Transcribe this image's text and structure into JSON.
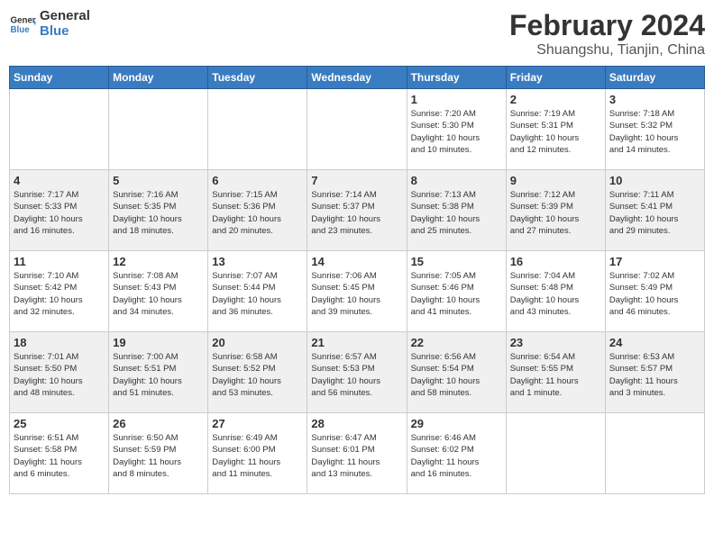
{
  "logo": {
    "line1": "General",
    "line2": "Blue"
  },
  "title": "February 2024",
  "subtitle": "Shuangshu, Tianjin, China",
  "days_of_week": [
    "Sunday",
    "Monday",
    "Tuesday",
    "Wednesday",
    "Thursday",
    "Friday",
    "Saturday"
  ],
  "weeks": [
    [
      {
        "day": "",
        "info": ""
      },
      {
        "day": "",
        "info": ""
      },
      {
        "day": "",
        "info": ""
      },
      {
        "day": "",
        "info": ""
      },
      {
        "day": "1",
        "info": "Sunrise: 7:20 AM\nSunset: 5:30 PM\nDaylight: 10 hours\nand 10 minutes."
      },
      {
        "day": "2",
        "info": "Sunrise: 7:19 AM\nSunset: 5:31 PM\nDaylight: 10 hours\nand 12 minutes."
      },
      {
        "day": "3",
        "info": "Sunrise: 7:18 AM\nSunset: 5:32 PM\nDaylight: 10 hours\nand 14 minutes."
      }
    ],
    [
      {
        "day": "4",
        "info": "Sunrise: 7:17 AM\nSunset: 5:33 PM\nDaylight: 10 hours\nand 16 minutes."
      },
      {
        "day": "5",
        "info": "Sunrise: 7:16 AM\nSunset: 5:35 PM\nDaylight: 10 hours\nand 18 minutes."
      },
      {
        "day": "6",
        "info": "Sunrise: 7:15 AM\nSunset: 5:36 PM\nDaylight: 10 hours\nand 20 minutes."
      },
      {
        "day": "7",
        "info": "Sunrise: 7:14 AM\nSunset: 5:37 PM\nDaylight: 10 hours\nand 23 minutes."
      },
      {
        "day": "8",
        "info": "Sunrise: 7:13 AM\nSunset: 5:38 PM\nDaylight: 10 hours\nand 25 minutes."
      },
      {
        "day": "9",
        "info": "Sunrise: 7:12 AM\nSunset: 5:39 PM\nDaylight: 10 hours\nand 27 minutes."
      },
      {
        "day": "10",
        "info": "Sunrise: 7:11 AM\nSunset: 5:41 PM\nDaylight: 10 hours\nand 29 minutes."
      }
    ],
    [
      {
        "day": "11",
        "info": "Sunrise: 7:10 AM\nSunset: 5:42 PM\nDaylight: 10 hours\nand 32 minutes."
      },
      {
        "day": "12",
        "info": "Sunrise: 7:08 AM\nSunset: 5:43 PM\nDaylight: 10 hours\nand 34 minutes."
      },
      {
        "day": "13",
        "info": "Sunrise: 7:07 AM\nSunset: 5:44 PM\nDaylight: 10 hours\nand 36 minutes."
      },
      {
        "day": "14",
        "info": "Sunrise: 7:06 AM\nSunset: 5:45 PM\nDaylight: 10 hours\nand 39 minutes."
      },
      {
        "day": "15",
        "info": "Sunrise: 7:05 AM\nSunset: 5:46 PM\nDaylight: 10 hours\nand 41 minutes."
      },
      {
        "day": "16",
        "info": "Sunrise: 7:04 AM\nSunset: 5:48 PM\nDaylight: 10 hours\nand 43 minutes."
      },
      {
        "day": "17",
        "info": "Sunrise: 7:02 AM\nSunset: 5:49 PM\nDaylight: 10 hours\nand 46 minutes."
      }
    ],
    [
      {
        "day": "18",
        "info": "Sunrise: 7:01 AM\nSunset: 5:50 PM\nDaylight: 10 hours\nand 48 minutes."
      },
      {
        "day": "19",
        "info": "Sunrise: 7:00 AM\nSunset: 5:51 PM\nDaylight: 10 hours\nand 51 minutes."
      },
      {
        "day": "20",
        "info": "Sunrise: 6:58 AM\nSunset: 5:52 PM\nDaylight: 10 hours\nand 53 minutes."
      },
      {
        "day": "21",
        "info": "Sunrise: 6:57 AM\nSunset: 5:53 PM\nDaylight: 10 hours\nand 56 minutes."
      },
      {
        "day": "22",
        "info": "Sunrise: 6:56 AM\nSunset: 5:54 PM\nDaylight: 10 hours\nand 58 minutes."
      },
      {
        "day": "23",
        "info": "Sunrise: 6:54 AM\nSunset: 5:55 PM\nDaylight: 11 hours\nand 1 minute."
      },
      {
        "day": "24",
        "info": "Sunrise: 6:53 AM\nSunset: 5:57 PM\nDaylight: 11 hours\nand 3 minutes."
      }
    ],
    [
      {
        "day": "25",
        "info": "Sunrise: 6:51 AM\nSunset: 5:58 PM\nDaylight: 11 hours\nand 6 minutes."
      },
      {
        "day": "26",
        "info": "Sunrise: 6:50 AM\nSunset: 5:59 PM\nDaylight: 11 hours\nand 8 minutes."
      },
      {
        "day": "27",
        "info": "Sunrise: 6:49 AM\nSunset: 6:00 PM\nDaylight: 11 hours\nand 11 minutes."
      },
      {
        "day": "28",
        "info": "Sunrise: 6:47 AM\nSunset: 6:01 PM\nDaylight: 11 hours\nand 13 minutes."
      },
      {
        "day": "29",
        "info": "Sunrise: 6:46 AM\nSunset: 6:02 PM\nDaylight: 11 hours\nand 16 minutes."
      },
      {
        "day": "",
        "info": ""
      },
      {
        "day": "",
        "info": ""
      }
    ]
  ]
}
